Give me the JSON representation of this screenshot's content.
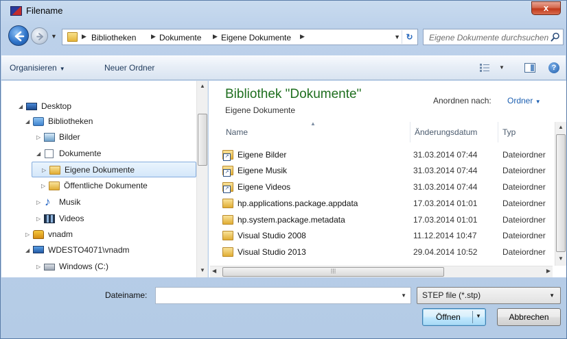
{
  "window": {
    "title": "Filename",
    "close_label": "x"
  },
  "address": {
    "crumbs": [
      "Bibliotheken",
      "Dokumente",
      "Eigene Dokumente"
    ],
    "search_placeholder": "Eigene Dokumente durchsuchen"
  },
  "toolbar": {
    "organize": "Organisieren",
    "new_folder": "Neuer Ordner",
    "help": "?"
  },
  "nav_tree": [
    {
      "label": "Desktop",
      "icon": "desktop-icon",
      "expanded": true
    },
    {
      "label": "Bibliotheken",
      "icon": "libraries-icon",
      "expanded": true
    },
    {
      "label": "Bilder",
      "icon": "pictures-library-icon",
      "expanded": false
    },
    {
      "label": "Dokumente",
      "icon": "documents-library-icon",
      "expanded": true
    },
    {
      "label": "Eigene Dokumente",
      "icon": "folder-icon",
      "expanded": false,
      "selected": true
    },
    {
      "label": "Öffentliche Dokumente",
      "icon": "folder-icon",
      "expanded": false
    },
    {
      "label": "Musik",
      "icon": "music-library-icon",
      "expanded": false
    },
    {
      "label": "Videos",
      "icon": "videos-library-icon",
      "expanded": false
    },
    {
      "label": "vnadm",
      "icon": "user-folder-icon",
      "expanded": false
    },
    {
      "label": "WDESTO4071\\vnadm",
      "icon": "computer-icon",
      "expanded": true
    },
    {
      "label": "Windows (C:)",
      "icon": "drive-icon",
      "expanded": false
    }
  ],
  "content": {
    "title": "Bibliothek \"Dokumente\"",
    "subtitle": "Eigene Dokumente",
    "arrange_label": "Anordnen nach:",
    "arrange_value": "Ordner",
    "columns": {
      "name": "Name",
      "date": "Änderungsdatum",
      "type": "Typ"
    },
    "files": [
      {
        "name": "Eigene Bilder",
        "date": "31.03.2014 07:44",
        "type": "Dateiordner",
        "icon": "folder-shortcut-icon"
      },
      {
        "name": "Eigene Musik",
        "date": "31.03.2014 07:44",
        "type": "Dateiordner",
        "icon": "folder-shortcut-icon"
      },
      {
        "name": "Eigene Videos",
        "date": "31.03.2014 07:44",
        "type": "Dateiordner",
        "icon": "folder-shortcut-icon"
      },
      {
        "name": "hp.applications.package.appdata",
        "date": "17.03.2014 01:01",
        "type": "Dateiordner",
        "icon": "folder-icon"
      },
      {
        "name": "hp.system.package.metadata",
        "date": "17.03.2014 01:01",
        "type": "Dateiordner",
        "icon": "folder-icon"
      },
      {
        "name": "Visual Studio 2008",
        "date": "11.12.2014 10:47",
        "type": "Dateiordner",
        "icon": "folder-icon"
      },
      {
        "name": "Visual Studio 2013",
        "date": "29.04.2014 10:52",
        "type": "Dateiordner",
        "icon": "folder-icon"
      }
    ]
  },
  "footer": {
    "filename_label": "Dateiname:",
    "filename_value": "",
    "filetype": "STEP file (*.stp)",
    "open_label": "Öffnen",
    "cancel_label": "Abbrechen"
  },
  "colors": {
    "library_title": "#1e6e1e",
    "link": "#1c5fb1",
    "close_button": "#c0391b"
  }
}
